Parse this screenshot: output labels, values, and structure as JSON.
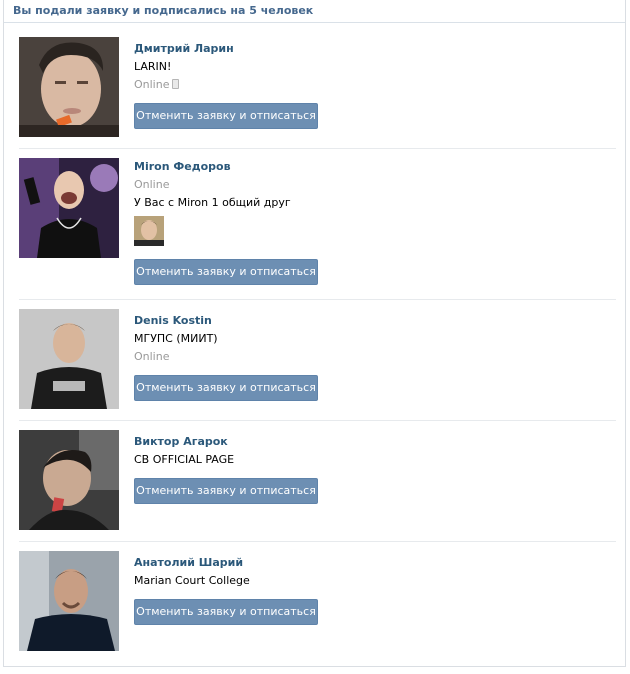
{
  "header": {
    "title": "Вы подали заявку и подписались на 5 человек"
  },
  "people": [
    {
      "name": "Дмитрий Ларин",
      "line1": "LARIN!",
      "status": "Online",
      "status_icon": "phone-icon",
      "button": "Отменить заявку и отписаться"
    },
    {
      "name": "Miron Федоров",
      "line1": "Online",
      "mutual_text": "У Вас с Miron 1 общий друг",
      "button": "Отменить заявку и отписаться"
    },
    {
      "name": "Denis Kostin",
      "line1": "МГУПС (МИИТ)",
      "status": "Online",
      "button": "Отменить заявку и отписаться"
    },
    {
      "name": "Виктор Агарок",
      "line1": "CB OFFICIAL PAGE",
      "button": "Отменить заявку и отписаться"
    },
    {
      "name": "Анатолий Шарий",
      "line1": "Marian Court College",
      "button": "Отменить заявку и отписаться"
    }
  ],
  "colors": {
    "link": "#2b587a",
    "header": "#45688e",
    "button_bg": "#6d8fb3",
    "muted": "#999999"
  }
}
